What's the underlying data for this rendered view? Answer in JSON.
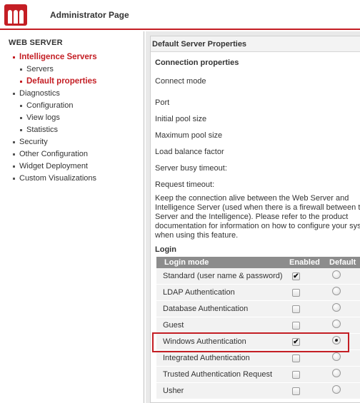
{
  "header": {
    "title": "Administrator Page"
  },
  "sidebar": {
    "heading": "WEB SERVER",
    "items": [
      {
        "label": "Intelligence Servers",
        "level": 0,
        "active": true
      },
      {
        "label": "Servers",
        "level": 1,
        "active": false
      },
      {
        "label": "Default properties",
        "level": 1,
        "active": true
      },
      {
        "label": "Diagnostics",
        "level": 0,
        "active": false
      },
      {
        "label": "Configuration",
        "level": 1,
        "active": false
      },
      {
        "label": "View logs",
        "level": 1,
        "active": false
      },
      {
        "label": "Statistics",
        "level": 1,
        "active": false
      },
      {
        "label": "Security",
        "level": 0,
        "active": false
      },
      {
        "label": "Other Configuration",
        "level": 0,
        "active": false
      },
      {
        "label": "Widget Deployment",
        "level": 0,
        "active": false
      },
      {
        "label": "Custom Visualizations",
        "level": 0,
        "active": false
      }
    ]
  },
  "main": {
    "title": "Default Server Properties",
    "connection": {
      "heading": "Connection properties",
      "rows": [
        "Connect mode",
        "Port",
        "Initial pool size",
        "Maximum pool size",
        "Load balance factor",
        "Server busy timeout:",
        "Request timeout:"
      ],
      "keep_alive": [
        "Keep the connection alive between the Web Server and",
        "Intelligence Server (used when there is a firewall between the",
        "Server and the Intelligence). Please refer to the product",
        "documentation for information on how to configure your syst",
        "when using this feature."
      ]
    },
    "login": {
      "heading": "Login",
      "columns": {
        "mode": "Login mode",
        "enabled": "Enabled",
        "default": "Default"
      },
      "rows": [
        {
          "mode": "Standard (user name & password)",
          "enabled": true,
          "default": false
        },
        {
          "mode": "LDAP Authentication",
          "enabled": false,
          "default": false
        },
        {
          "mode": "Database Authentication",
          "enabled": false,
          "default": false
        },
        {
          "mode": "Guest",
          "enabled": false,
          "default": false
        },
        {
          "mode": "Windows Authentication",
          "enabled": true,
          "default": true
        },
        {
          "mode": "Integrated Authentication",
          "enabled": false,
          "default": false
        },
        {
          "mode": "Trusted Authentication Request",
          "enabled": false,
          "default": false
        },
        {
          "mode": "Usher",
          "enabled": false,
          "default": false
        }
      ],
      "check_mark": "✔"
    }
  },
  "colors": {
    "accent": "#c41e24",
    "table_header": "#8c8c8c",
    "row_background": "#f2f2f2"
  },
  "icons": {
    "logo": "microstrategy-logo-icon",
    "check": "checkmark-icon"
  }
}
